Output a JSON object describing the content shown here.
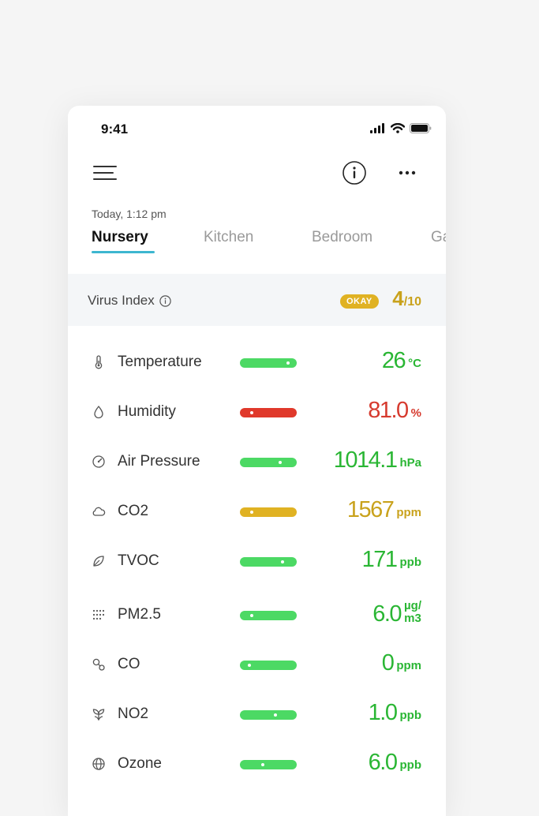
{
  "status_bar": {
    "time": "9:41"
  },
  "header": {
    "timestamp": "Today, 1:12 pm"
  },
  "tabs": [
    {
      "label": "Nursery",
      "active": true
    },
    {
      "label": "Kitchen",
      "active": false
    },
    {
      "label": "Bedroom",
      "active": false
    },
    {
      "label": "Ga",
      "active": false
    }
  ],
  "virus_index": {
    "label": "Virus Index",
    "badge": "OKAY",
    "score": "4",
    "score_max": "/10",
    "color": "#c9a21c"
  },
  "colors": {
    "green": "#4cd964",
    "red": "#e0392b",
    "yellow": "#e0b223",
    "accent": "#3db6d0"
  },
  "metrics": [
    {
      "name": "Temperature",
      "icon": "thermometer-icon",
      "value": "26",
      "unit": "°C",
      "status": "good",
      "level": 0.92,
      "bar_color": "#4cd964",
      "text_color": "#2ab634"
    },
    {
      "name": "Humidity",
      "icon": "droplet-icon",
      "value": "81.0",
      "unit": "%",
      "status": "bad",
      "level": 0.15,
      "bar_color": "#e0392b",
      "text_color": "#d63a2e"
    },
    {
      "name": "Air Pressure",
      "icon": "gauge-icon",
      "value": "1014.1",
      "unit": "hPa",
      "status": "good",
      "level": 0.75,
      "bar_color": "#4cd964",
      "text_color": "#2ab634"
    },
    {
      "name": "CO2",
      "icon": "cloud-icon",
      "value": "1567",
      "unit": "ppm",
      "status": "warning",
      "level": 0.15,
      "bar_color": "#e0b223",
      "text_color": "#c9a21c"
    },
    {
      "name": "TVOC",
      "icon": "leaf-icon",
      "value": "171",
      "unit": "ppb",
      "status": "good",
      "level": 0.8,
      "bar_color": "#4cd964",
      "text_color": "#2ab634"
    },
    {
      "name": "PM2.5",
      "icon": "particles-icon",
      "value": "6.0",
      "unit_top": "µg/",
      "unit_bottom": "m3",
      "status": "good",
      "level": 0.15,
      "bar_color": "#4cd964",
      "text_color": "#2ab634"
    },
    {
      "name": "CO",
      "icon": "molecule-icon",
      "value": "0",
      "unit": "ppm",
      "status": "good",
      "level": 0.1,
      "bar_color": "#4cd964",
      "text_color": "#2ab634"
    },
    {
      "name": "NO2",
      "icon": "plant-icon",
      "value": "1.0",
      "unit": "ppb",
      "status": "good",
      "level": 0.65,
      "bar_color": "#4cd964",
      "text_color": "#2ab634"
    },
    {
      "name": "Ozone",
      "icon": "globe-icon",
      "value": "6.0",
      "unit": "ppb",
      "status": "good",
      "level": 0.38,
      "bar_color": "#4cd964",
      "text_color": "#2ab634"
    }
  ]
}
